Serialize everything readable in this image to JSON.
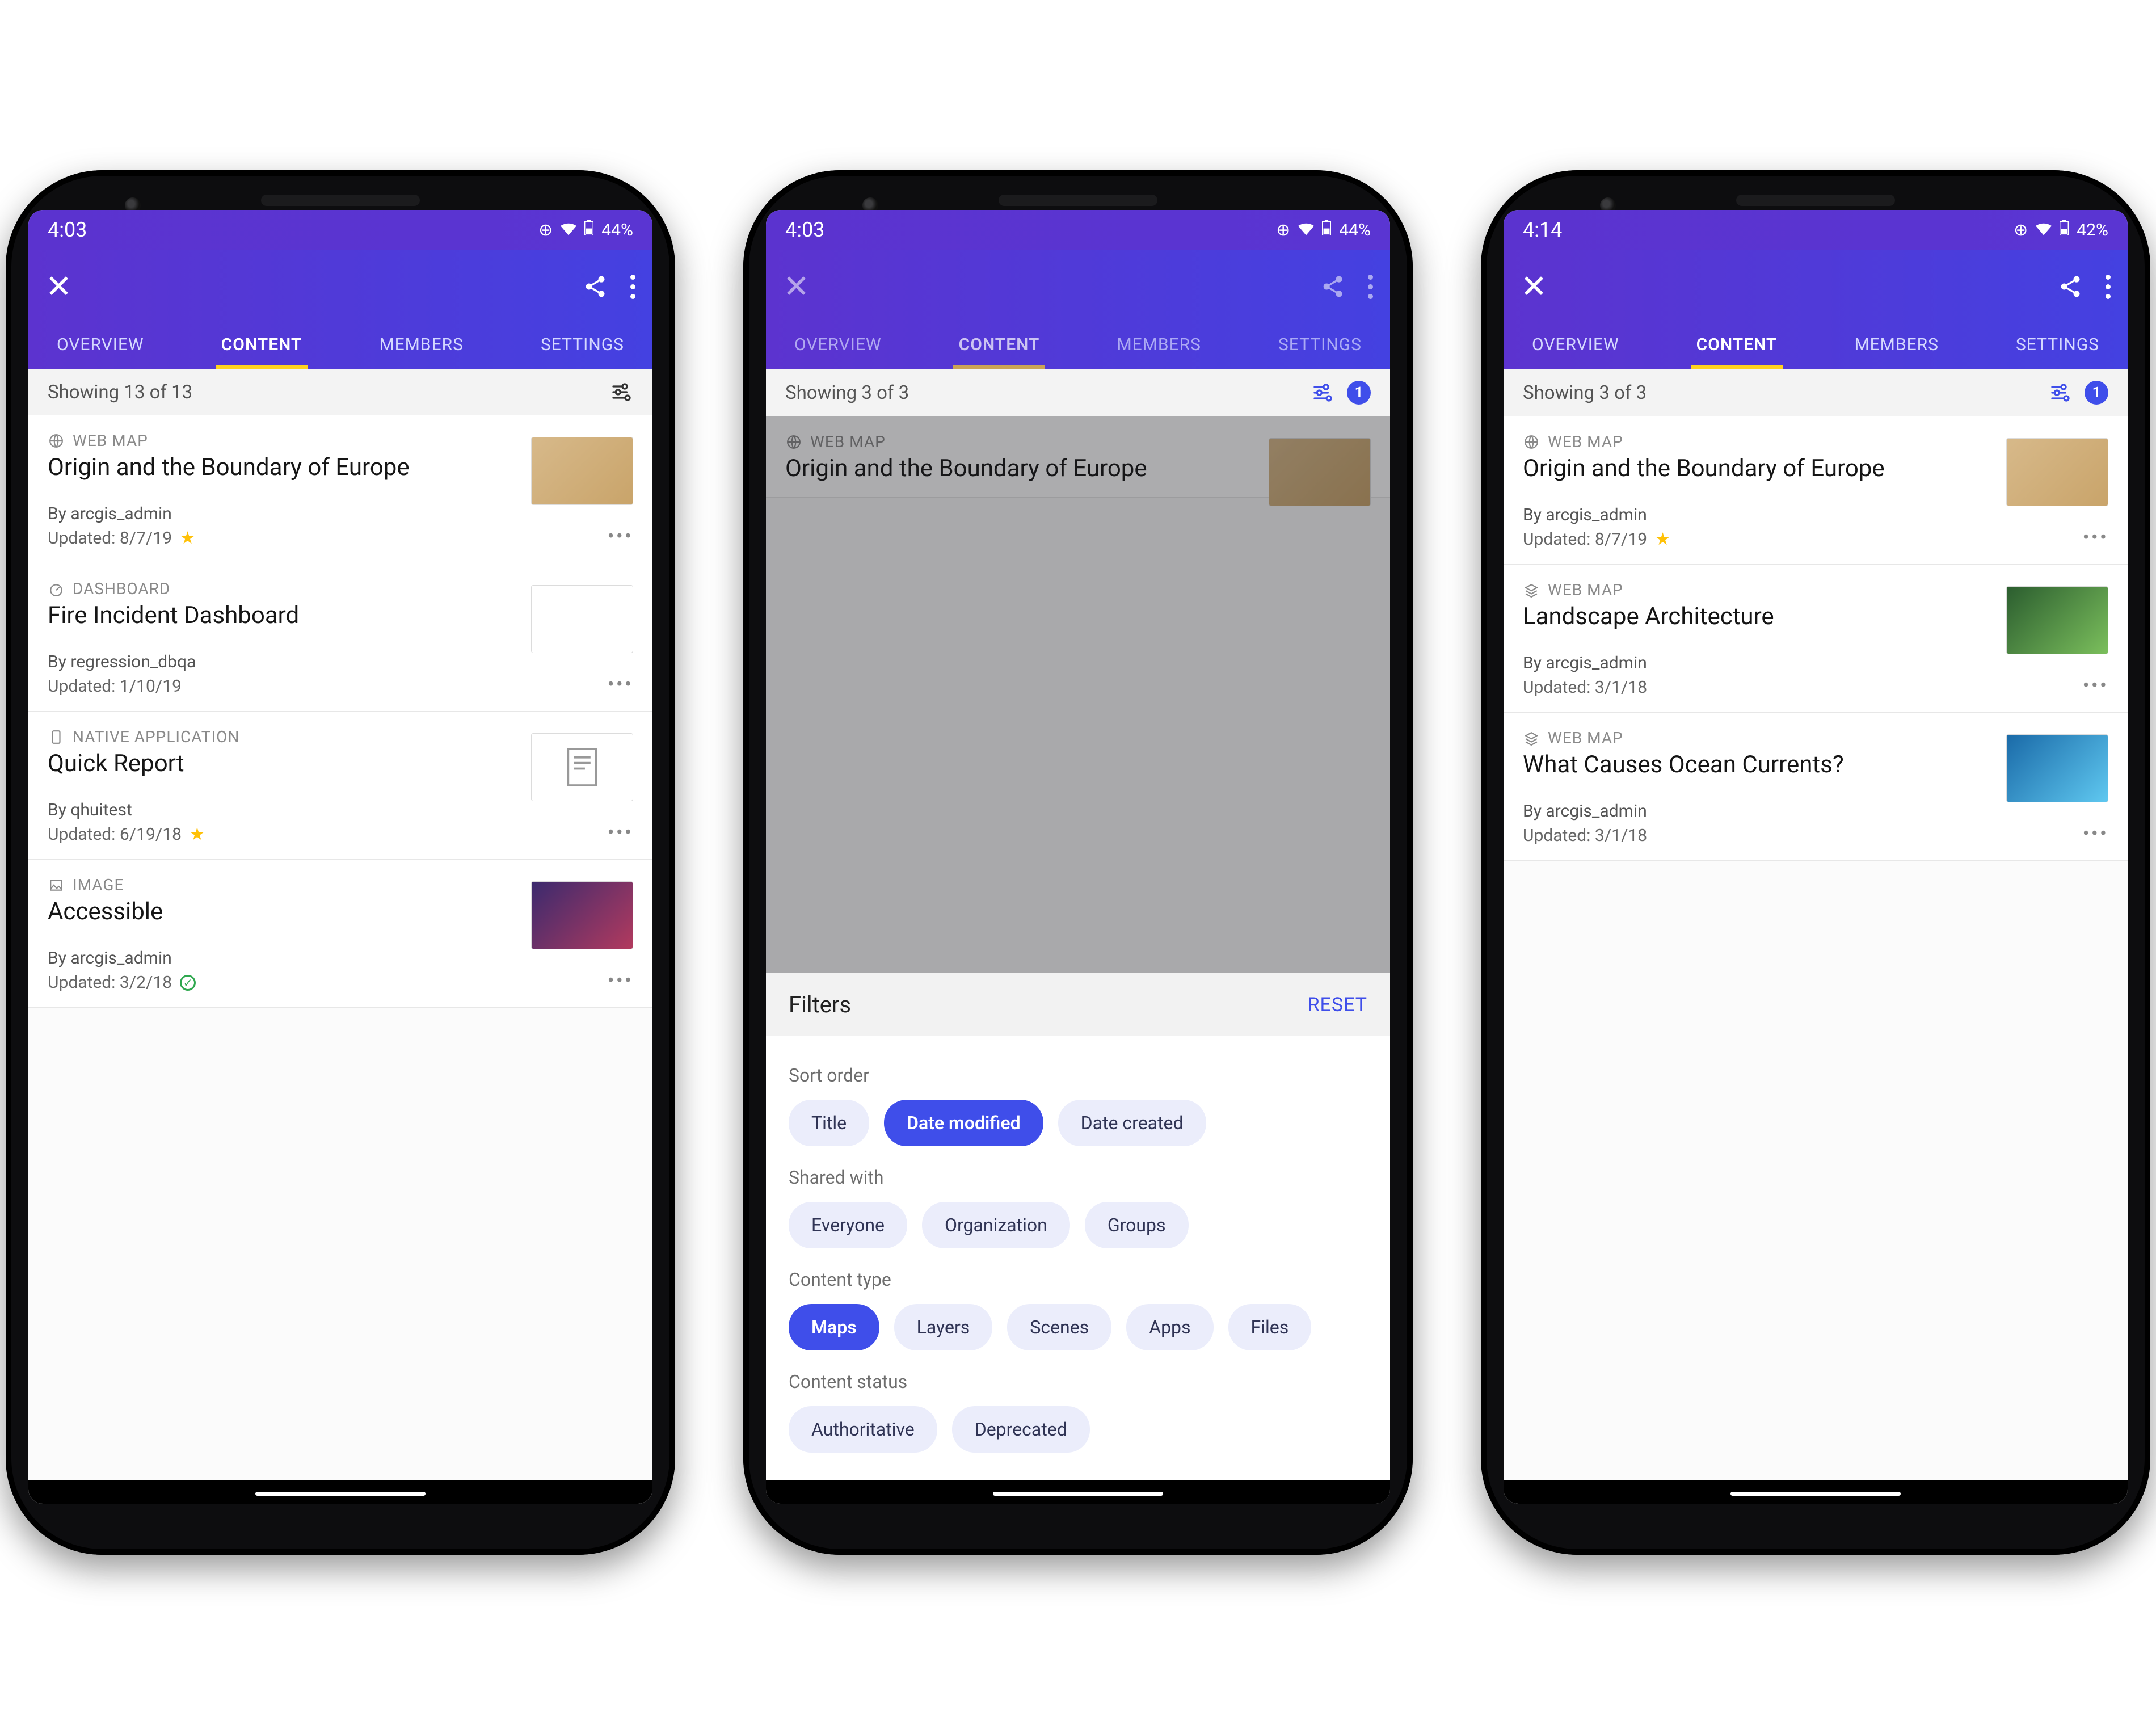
{
  "phones": [
    {
      "statusbar": {
        "time": "4:03",
        "battery": "44%"
      },
      "tabs": {
        "overview": "OVERVIEW",
        "content": "CONTENT",
        "members": "MEMBERS",
        "settings": "SETTINGS",
        "active": "content"
      },
      "subbar": {
        "showing": "Showing 13 of 13",
        "badge": null
      },
      "items": [
        {
          "type": "WEB MAP",
          "title": "Origin and the Boundary of Europe",
          "by": "By arcgis_admin",
          "updated": "Updated: 8/7/19",
          "flag": "star",
          "thumb": "map"
        },
        {
          "type": "DASHBOARD",
          "title": "Fire Incident Dashboard",
          "by": "By regression_dbqa",
          "updated": "Updated: 1/10/19",
          "flag": null,
          "thumb": "dash"
        },
        {
          "type": "NATIVE APPLICATION",
          "title": "Quick Report",
          "by": "By qhuitest",
          "updated": "Updated: 6/19/18",
          "flag": "star",
          "thumb": "report"
        },
        {
          "type": "IMAGE",
          "title": "Accessible",
          "by": "By arcgis_admin",
          "updated": "Updated: 3/2/18",
          "flag": "check",
          "thumb": "image"
        }
      ]
    },
    {
      "statusbar": {
        "time": "4:03",
        "battery": "44%"
      },
      "tabs": {
        "overview": "OVERVIEW",
        "content": "CONTENT",
        "members": "MEMBERS",
        "settings": "SETTINGS",
        "active": "content"
      },
      "subbar": {
        "showing": "Showing 3 of 3",
        "badge": "1"
      },
      "items": [
        {
          "type": "WEB MAP",
          "title": "Origin and the Boundary of Europe",
          "by": "",
          "updated": "",
          "flag": null,
          "thumb": "map"
        }
      ],
      "filters": {
        "title": "Filters",
        "reset": "RESET",
        "sections": {
          "sort_order": {
            "label": "Sort order",
            "options": [
              "Title",
              "Date modified",
              "Date created"
            ],
            "selected": "Date modified"
          },
          "shared_with": {
            "label": "Shared with",
            "options": [
              "Everyone",
              "Organization",
              "Groups"
            ],
            "selected": null
          },
          "content_type": {
            "label": "Content type",
            "options": [
              "Maps",
              "Layers",
              "Scenes",
              "Apps",
              "Files"
            ],
            "selected": "Maps"
          },
          "content_status": {
            "label": "Content status",
            "options": [
              "Authoritative",
              "Deprecated"
            ],
            "selected": null
          }
        }
      }
    },
    {
      "statusbar": {
        "time": "4:14",
        "battery": "42%"
      },
      "tabs": {
        "overview": "OVERVIEW",
        "content": "CONTENT",
        "members": "MEMBERS",
        "settings": "SETTINGS",
        "active": "content"
      },
      "subbar": {
        "showing": "Showing 3 of 3",
        "badge": "1"
      },
      "items": [
        {
          "type": "WEB MAP",
          "title": "Origin and the Boundary of Europe",
          "by": "By arcgis_admin",
          "updated": "Updated: 8/7/19",
          "flag": "star",
          "thumb": "map"
        },
        {
          "type": "WEB MAP",
          "title": "Landscape Architecture",
          "by": "By arcgis_admin",
          "updated": "Updated: 3/1/18",
          "flag": null,
          "thumb": "aerial"
        },
        {
          "type": "WEB MAP",
          "title": "What Causes Ocean Currents?",
          "by": "By arcgis_admin",
          "updated": "Updated: 3/1/18",
          "flag": null,
          "thumb": "ocean"
        }
      ]
    }
  ],
  "icons": {
    "vibrate": "◐",
    "wifi": "▲",
    "battery_glyph": "▮"
  }
}
